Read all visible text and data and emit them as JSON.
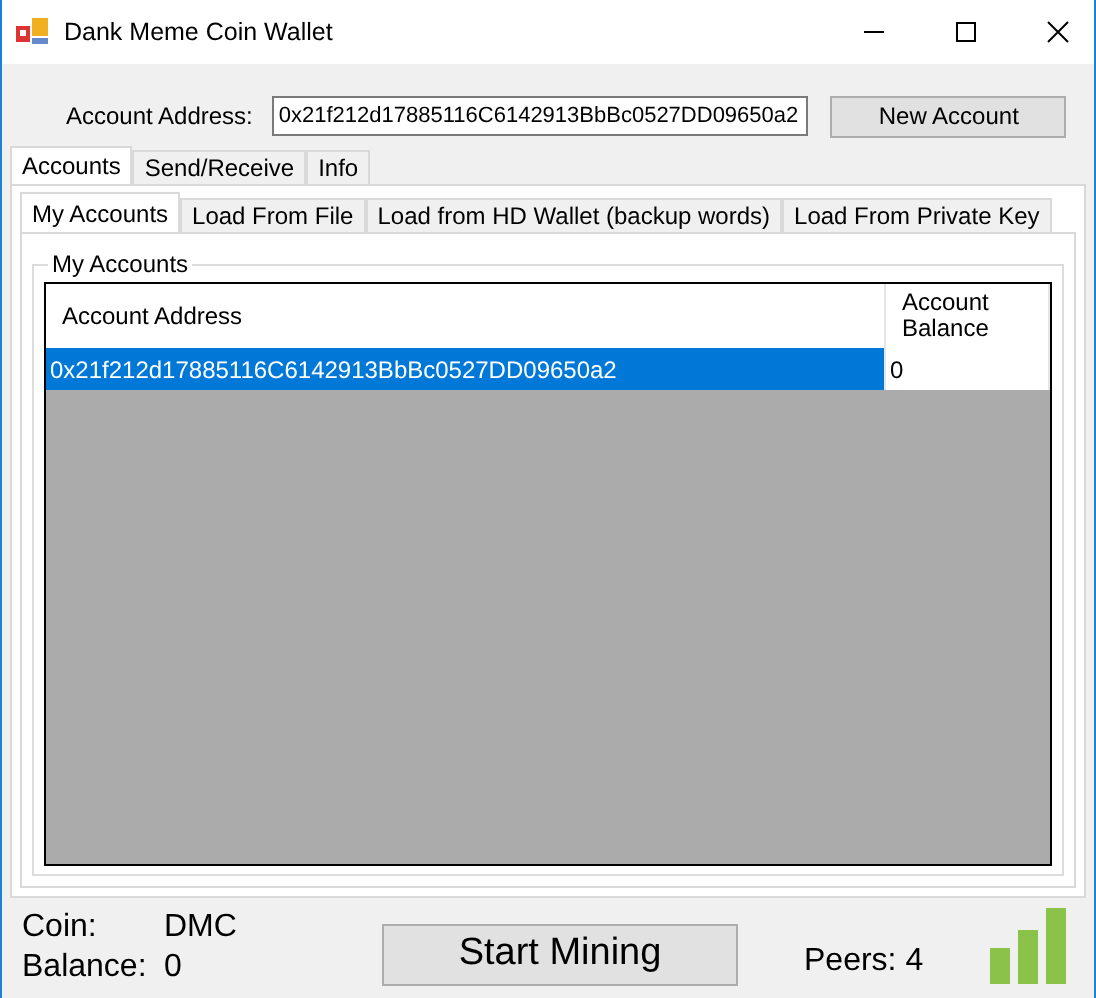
{
  "window": {
    "title": "Dank Meme Coin Wallet"
  },
  "address_bar": {
    "label": "Account Address:",
    "value": "0x21f212d17885116C6142913BbBc0527DD09650a2",
    "button": "New Account"
  },
  "tabs": [
    {
      "label": "Accounts",
      "selected": true
    },
    {
      "label": "Send/Receive",
      "selected": false
    },
    {
      "label": "Info",
      "selected": false
    }
  ],
  "subtabs": [
    {
      "label": "My Accounts",
      "selected": true
    },
    {
      "label": "Load From File",
      "selected": false
    },
    {
      "label": "Load from HD Wallet (backup words)",
      "selected": false
    },
    {
      "label": "Load From Private Key",
      "selected": false
    }
  ],
  "group": {
    "title": "My Accounts"
  },
  "table": {
    "columns": [
      "Account Address",
      "Account Balance"
    ],
    "rows": [
      {
        "cells": [
          "0x21f212d17885116C6142913BbBc0527DD09650a2",
          "0"
        ],
        "selected": true
      }
    ]
  },
  "status": {
    "coin_label": "Coin:",
    "coin": "DMC",
    "balance_label": "Balance:",
    "balance": "0",
    "button": "Start Mining",
    "peers": "Peers: 4"
  }
}
